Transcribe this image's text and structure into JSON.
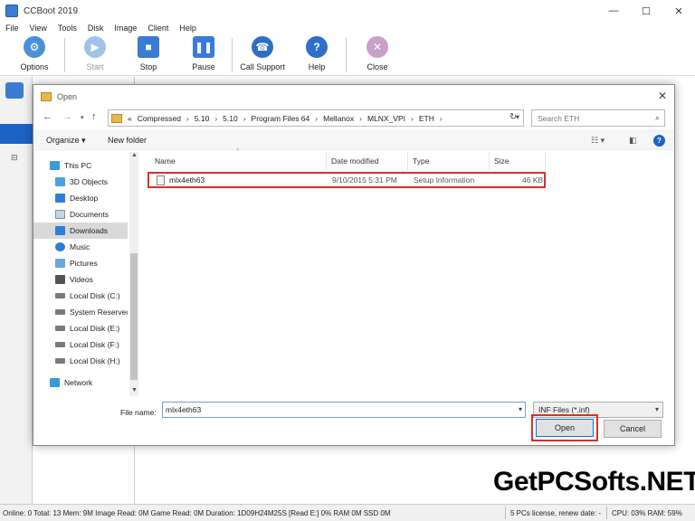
{
  "app": {
    "title": "CCBoot 2019",
    "minimize": "—",
    "maximize": "☐",
    "close": "✕"
  },
  "menu": [
    "File",
    "View",
    "Tools",
    "Disk",
    "Image",
    "Client",
    "Help"
  ],
  "toolbar": {
    "options": "Options",
    "start": "Start",
    "stop": "Stop",
    "pause": "Pause",
    "call_support": "Call Support",
    "help": "Help",
    "close": "Close"
  },
  "left_pane": {
    "expander": "⊟"
  },
  "dialog": {
    "title": "Open",
    "close": "✕",
    "path": [
      "«",
      "Compressed",
      "5.10",
      "5.10",
      "Program Files 64",
      "Mellanox",
      "MLNX_VPI",
      "ETH"
    ],
    "search_placeholder": "Search ETH",
    "organize": "Organize ▾",
    "new_folder": "New folder",
    "nav_items": [
      "This PC",
      "3D Objects",
      "Desktop",
      "Documents",
      "Downloads",
      "Music",
      "Pictures",
      "Videos",
      "Local Disk (C:)",
      "System Reservec",
      "Local Disk (E:)",
      "Local Disk (F:)",
      "Local Disk (H:)",
      "Network"
    ],
    "columns": {
      "name": "Name",
      "date": "Date modified",
      "type": "Type",
      "size": "Size"
    },
    "files": [
      {
        "name": "mlx4eth63",
        "date": "9/10/2015 5:31 PM",
        "type": "Setup Information",
        "size": "46 KB"
      }
    ],
    "filename_label": "File name:",
    "filename_value": "mlx4eth63",
    "filetype": "INF Files (*.inf)",
    "open": "Open",
    "cancel": "Cancel"
  },
  "status": {
    "left": "Online: 0 Total: 13 Mem: 9M Image Read: 0M Game Read: 0M Duration: 1D09H24M25S [Read E:] 0% RAM 0M SSD 0M",
    "license": "5 PCs license, renew date: -",
    "cpu": "CPU: 03% RAM: 59%"
  },
  "watermark": "GetPCSofts.NET",
  "colors": {
    "accent": "#1c63c6",
    "highlight": "#d9302c"
  }
}
